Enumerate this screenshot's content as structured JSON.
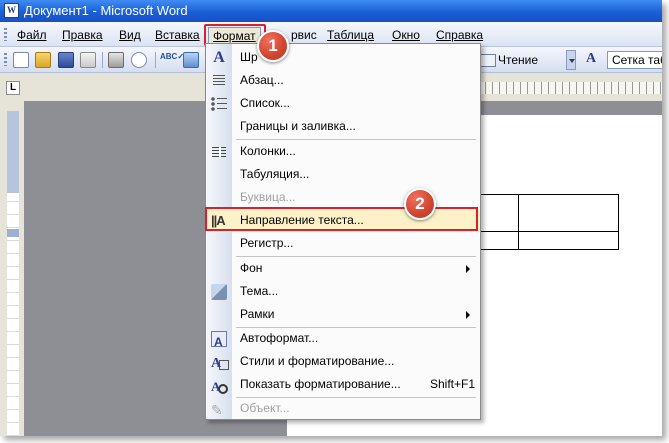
{
  "window": {
    "title": "Документ1 - Microsoft Word",
    "app_icon": "word-icon"
  },
  "menubar": {
    "items": [
      {
        "label": "Файл"
      },
      {
        "label": "Правка"
      },
      {
        "label": "Вид"
      },
      {
        "label": "Вставка"
      },
      {
        "label": "Формат"
      },
      {
        "label": "рвис"
      },
      {
        "label": "Таблица"
      },
      {
        "label": "Окно"
      },
      {
        "label": "Справка"
      }
    ],
    "active": "Формат"
  },
  "toolbar": {
    "icons": [
      "new-document-icon",
      "open-folder-icon",
      "save-icon",
      "permission-icon",
      "print-icon",
      "print-preview-icon",
      "spelling-icon",
      "research-icon"
    ],
    "read_label": "Чтение",
    "style_box": "Сетка таб"
  },
  "document": {
    "cell_line1": "ие",
    "cell_line2": "ord"
  },
  "format_menu": {
    "items": [
      {
        "label": "Шр",
        "icon": "font-icon"
      },
      {
        "label": "Абзац...",
        "icon": "paragraph-icon"
      },
      {
        "label": "Список...",
        "icon": "bullets-icon"
      },
      {
        "label": "Границы и заливка..."
      },
      {
        "label": "Колонки...",
        "icon": "columns-icon"
      },
      {
        "label": "Табуляция..."
      },
      {
        "label": "Буквица...",
        "disabled": true
      },
      {
        "label": "Направление текста...",
        "icon": "text-direction-icon"
      },
      {
        "label": "Регистр..."
      },
      {
        "label": "Фон",
        "submenu": true
      },
      {
        "label": "Тема...",
        "icon": "theme-icon"
      },
      {
        "label": "Рамки",
        "submenu": true
      },
      {
        "label": "Автоформат...",
        "icon": "autoformat-icon"
      },
      {
        "label": "Стили и форматирование...",
        "icon": "styles-icon"
      },
      {
        "label": "Показать форматирование...",
        "icon": "reveal-formatting-icon",
        "shortcut": "Shift+F1"
      },
      {
        "label": "Объект...",
        "icon": "object-icon",
        "disabled": true
      }
    ]
  },
  "callouts": {
    "step1": "1",
    "step2": "2"
  },
  "colors": {
    "highlight": "#d7222b",
    "badge": "#d0452f",
    "title_bar": "#1a5fd6"
  }
}
